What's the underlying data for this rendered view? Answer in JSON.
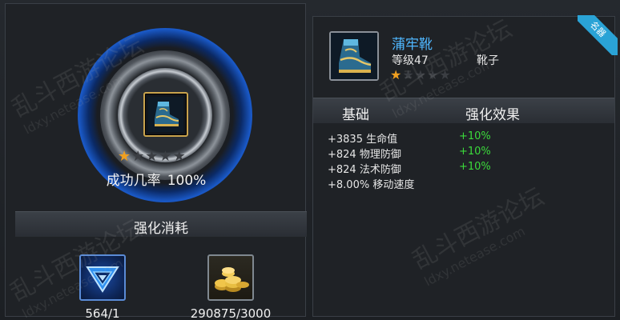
{
  "enhance": {
    "success_label": "成功几率",
    "success_rate": "100%",
    "stars_left": [
      "on",
      "off",
      "off",
      "off",
      "off"
    ],
    "cost_title": "强化消耗",
    "costs": [
      {
        "icon": "enhance-crystal-icon",
        "value": "564/1"
      },
      {
        "icon": "gold-coins-icon",
        "value": "290875/3000"
      }
    ]
  },
  "item": {
    "name": "蒲牢靴",
    "level": "等级47",
    "type": "靴子",
    "stars": [
      "on",
      "off",
      "off",
      "off",
      "off"
    ],
    "badge": "名器",
    "icon": "boots-icon"
  },
  "table": {
    "col_base": "基础",
    "col_effect": "强化效果",
    "rows": [
      {
        "base": "+3835 生命值",
        "bonus": "+10%"
      },
      {
        "base": "+824 物理防御",
        "bonus": "+10%"
      },
      {
        "base": "+824 法术防御",
        "bonus": "+10%"
      },
      {
        "base": "+8.00% 移动速度",
        "bonus": ""
      }
    ]
  },
  "watermark": {
    "main": "乱斗西游论坛",
    "sub": "ldxy.netease.com"
  },
  "colors": {
    "item_name": "#4fb7ff",
    "bonus_green": "#3bdb3b",
    "star_gold": "#f0a020",
    "badge_blue": "#2aa3d6",
    "ring_blue": "#1a59c7"
  }
}
